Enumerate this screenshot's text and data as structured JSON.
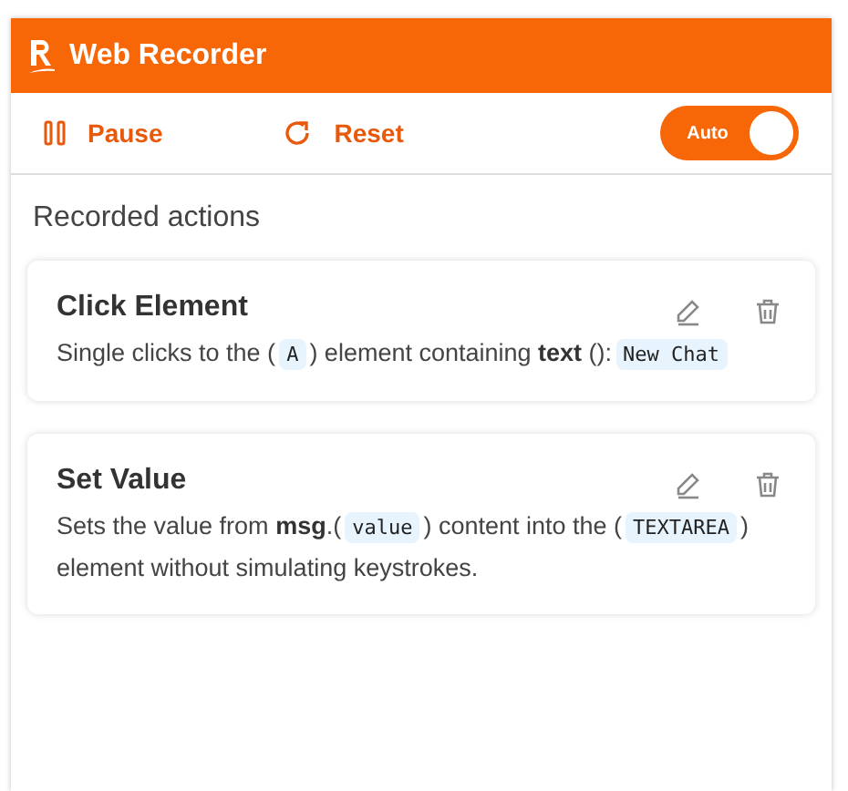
{
  "header": {
    "title": "Web Recorder"
  },
  "toolbar": {
    "pause": "Pause",
    "reset": "Reset",
    "toggle": {
      "label": "Auto",
      "on": true
    }
  },
  "section_title": "Recorded actions",
  "actions": [
    {
      "title": "Click Element",
      "description": [
        {
          "kind": "text",
          "text": "Single clicks to the ("
        },
        {
          "kind": "code",
          "text": "A"
        },
        {
          "kind": "text",
          "text": ") element containing "
        },
        {
          "kind": "bold",
          "text": "text"
        },
        {
          "kind": "text",
          "text": " ():"
        },
        {
          "kind": "code",
          "text": "New Chat"
        }
      ]
    },
    {
      "title": "Set Value",
      "description": [
        {
          "kind": "text",
          "text": "Sets the value from "
        },
        {
          "kind": "bold",
          "text": "msg"
        },
        {
          "kind": "text",
          "text": ".("
        },
        {
          "kind": "code",
          "text": "value"
        },
        {
          "kind": "text",
          "text": ") content into the ("
        },
        {
          "kind": "code",
          "text": "TEXTAREA"
        },
        {
          "kind": "text",
          "text": ") element without simulating keystrokes."
        }
      ]
    }
  ]
}
